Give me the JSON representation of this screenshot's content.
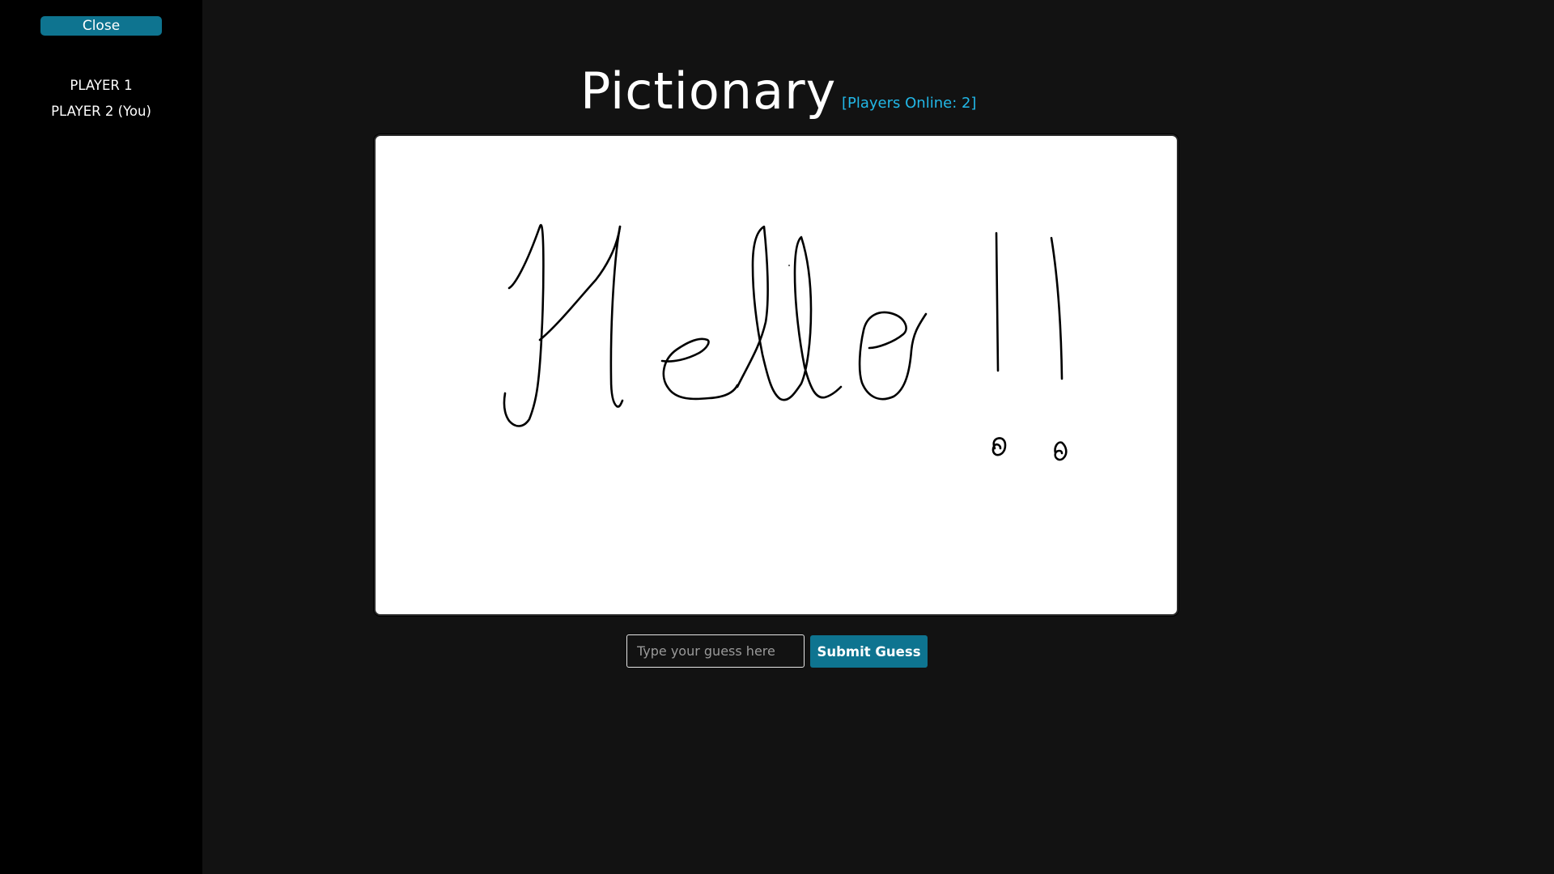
{
  "sidebar": {
    "close_label": "Close",
    "players": [
      {
        "label": "PLAYER 1"
      },
      {
        "label": "PLAYER 2 (You)"
      }
    ]
  },
  "header": {
    "title": "Pictionary",
    "players_online": "[Players Online: 2]"
  },
  "guess": {
    "placeholder": "Type your guess here",
    "value": "",
    "submit_label": "Submit Guess"
  },
  "colors": {
    "accent": "#0e7490",
    "online_text": "#22b8e8",
    "background": "#121212",
    "sidebar": "#000000",
    "canvas": "#ffffff",
    "ink": "#000000"
  }
}
